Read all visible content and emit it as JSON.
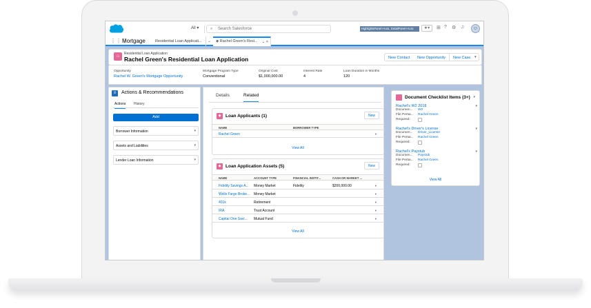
{
  "header": {
    "search_scope": "All",
    "search_placeholder": "Search Salesforce",
    "highlights_label": "HighlightsPanel+Aura, DetailPanel+Aura"
  },
  "nav": {
    "app_name": "Mortgage",
    "tabs": [
      {
        "label": "Residential Loan Applicati..."
      },
      {
        "label": "Rachel Green's Resi..."
      }
    ]
  },
  "record": {
    "type": "Residential Loan Application",
    "title": "Rachel Green's Residential Loan Application",
    "buttons": [
      "New Contact",
      "New Opportunity",
      "New Case"
    ],
    "fields": [
      {
        "label": "Opportunity",
        "value": "Rachel W. Green's Mortgage Opportunity",
        "link": true
      },
      {
        "label": "Mortgage Program Type",
        "value": "Conventional",
        "link": false
      },
      {
        "label": "Original Cost",
        "value": "$1,000,000.00",
        "link": false
      },
      {
        "label": "Interest Rate",
        "value": "4",
        "link": false
      },
      {
        "label": "Loan Duration in Months",
        "value": "120",
        "link": false
      }
    ]
  },
  "actions_panel": {
    "title": "Actions & Recommendations",
    "tabs": [
      "Actions",
      "History"
    ],
    "add_label": "Add",
    "items": [
      "Borrower Information",
      "Assets and Liabilities",
      "Lender Loan Information"
    ]
  },
  "main": {
    "tabs": [
      "Details",
      "Related"
    ],
    "applicants": {
      "title": "Loan Applicants (1)",
      "new_label": "New",
      "columns": [
        "NAME",
        "BORROWER TYPE"
      ],
      "rows": [
        [
          "Rachel Green",
          ""
        ]
      ],
      "view_all": "View All"
    },
    "assets": {
      "title": "Loan Application Assets (5)",
      "new_label": "New",
      "columns": [
        "NAME",
        "ACCOUNT TYPE",
        "FINANCIAL INSTIT...",
        "CASH OR MARKET ..."
      ],
      "rows": [
        [
          "Fidelity Savings A...",
          "Money Market",
          "Fidelity",
          "$200,000.00"
        ],
        [
          "Wells Fargo Broke...",
          "Money Market",
          "",
          ""
        ],
        [
          "401k",
          "Retirement",
          "",
          ""
        ],
        [
          "IRA",
          "Trust Account",
          "",
          ""
        ],
        [
          "Capital One Savi...",
          "Mutual Fund",
          "",
          ""
        ]
      ],
      "view_all": "View All"
    }
  },
  "checklist": {
    "title": "Document Checklist Items (3+)",
    "labels": {
      "document": "Documen...",
      "file": "File Pertai...",
      "required": "Required:"
    },
    "items": [
      {
        "name": "Rachel's W2 2018",
        "document": "W2",
        "file": "Rachel Green"
      },
      {
        "name": "Rachel's Driver's License",
        "document": "Driver_License",
        "file": "Rachel Green"
      },
      {
        "name": "Rachel's Paystub",
        "document": "Paystub",
        "file": "Rachel Green"
      }
    ],
    "view_all": "View All"
  },
  "colors": {
    "brand_blue": "#0070d2",
    "record_icon": "#e56798",
    "tab_indicator": "#1589ee",
    "page_bg": "#b0c4df"
  }
}
